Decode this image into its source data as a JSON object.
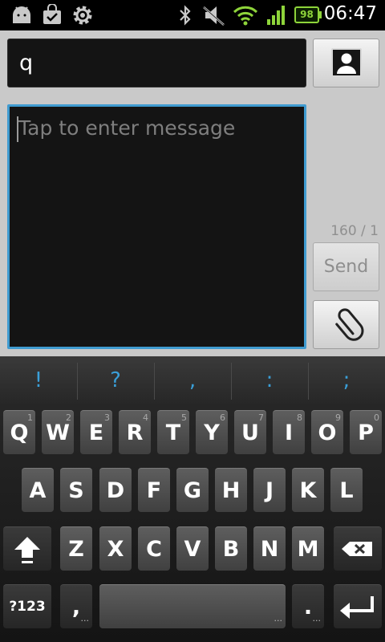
{
  "status_bar": {
    "time": "06:47",
    "battery_level": "98",
    "icons": [
      "android-debug-icon",
      "market-download-icon",
      "settings-gear-icon",
      "bluetooth-icon",
      "mute-icon",
      "wifi-icon",
      "signal-icon",
      "battery-icon"
    ],
    "accent_color": "#8ed43a"
  },
  "compose": {
    "to_value": "q",
    "contact_button": "contact-picker",
    "message_placeholder": "Tap to enter message",
    "char_counter": "160 / 1",
    "send_label": "Send",
    "attach_button": "attachment",
    "focus_color": "#3f9bd0"
  },
  "keyboard": {
    "suggestions": [
      "!",
      "?",
      ",",
      ":",
      ";"
    ],
    "row1": [
      {
        "k": "Q",
        "n": "1"
      },
      {
        "k": "W",
        "n": "2"
      },
      {
        "k": "E",
        "n": "3"
      },
      {
        "k": "R",
        "n": "4"
      },
      {
        "k": "T",
        "n": "5"
      },
      {
        "k": "Y",
        "n": "6"
      },
      {
        "k": "U",
        "n": "7"
      },
      {
        "k": "I",
        "n": "8"
      },
      {
        "k": "O",
        "n": "9"
      },
      {
        "k": "P",
        "n": "0"
      }
    ],
    "row2": [
      "A",
      "S",
      "D",
      "F",
      "G",
      "H",
      "J",
      "K",
      "L"
    ],
    "row3": [
      "Z",
      "X",
      "C",
      "V",
      "B",
      "N",
      "M"
    ],
    "symbols_label": "?123",
    "comma_label": ",",
    "period_label": ".",
    "ellipsis": "..."
  }
}
